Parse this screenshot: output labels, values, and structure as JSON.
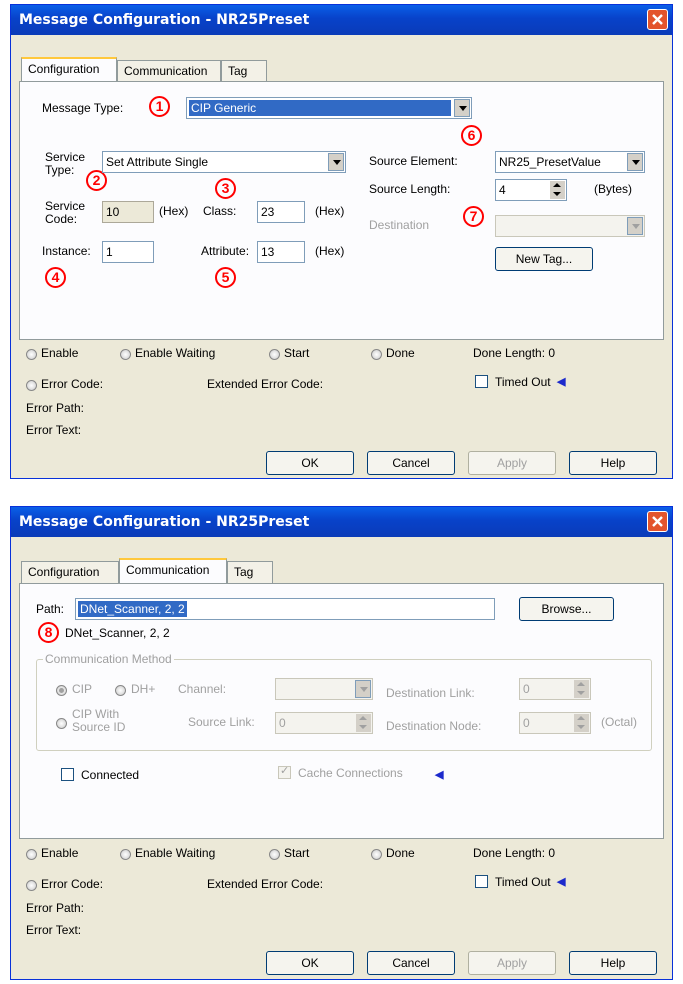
{
  "dialog1": {
    "title": "Message Configuration - NR25Preset",
    "tabs": [
      "Configuration",
      "Communication",
      "Tag"
    ],
    "message_type_label": "Message Type:",
    "message_type_value": "CIP Generic",
    "service_type_label_1": "Service",
    "service_type_label_2": "Type:",
    "service_type_value": "Set Attribute Single",
    "service_code_label_1": "Service",
    "service_code_label_2": "Code:",
    "service_code_value": "10",
    "hex_label": "(Hex)",
    "class_label": "Class:",
    "class_value": "23",
    "instance_label": "Instance:",
    "instance_value": "1",
    "attribute_label": "Attribute:",
    "attribute_value": "13",
    "source_element_label": "Source Element:",
    "source_element_value": "NR25_PresetValue",
    "source_length_label": "Source Length:",
    "source_length_value": "4",
    "bytes_label": "(Bytes)",
    "destination_label": "Destination",
    "new_tag_button": "New Tag...",
    "callouts": [
      "1",
      "2",
      "3",
      "4",
      "5",
      "6",
      "7"
    ]
  },
  "dialog2": {
    "title": "Message Configuration - NR25Preset",
    "tabs": [
      "Configuration",
      "Communication",
      "Tag"
    ],
    "path_label": "Path:",
    "path_value": "DNet_Scanner, 2, 2",
    "path_resolved": "DNet_Scanner, 2, 2",
    "browse_button": "Browse...",
    "callout": "8",
    "comm_method_label": "Communication Method",
    "cip_label": "CIP",
    "dhplus_label": "DH+",
    "channel_label": "Channel:",
    "destination_link_label": "Destination Link:",
    "destination_link_value": "0",
    "cip_with_source_1": "CIP With",
    "cip_with_source_2": "Source ID",
    "source_link_label": "Source Link:",
    "source_link_value": "0",
    "destination_node_label": "Destination Node:",
    "destination_node_value": "0",
    "octal_label": "(Octal)",
    "connected_label": "Connected",
    "cache_connections_label": "Cache Connections"
  },
  "status": {
    "enable": "Enable",
    "enable_waiting": "Enable Waiting",
    "start": "Start",
    "done": "Done",
    "done_length": "Done Length: 0",
    "error_code": "Error Code:",
    "extended_error_code": "Extended Error Code:",
    "timed_out": "Timed Out",
    "error_path": "Error Path:",
    "error_text": "Error Text:"
  },
  "buttons": {
    "ok": "OK",
    "cancel": "Cancel",
    "apply": "Apply",
    "help": "Help"
  },
  "colors": {
    "title_bar": "#0842c9",
    "callout": "#ff0000",
    "selection": "#316ac5"
  },
  "icons": {
    "close": "close-icon",
    "arrow": "left-arrow-icon"
  }
}
